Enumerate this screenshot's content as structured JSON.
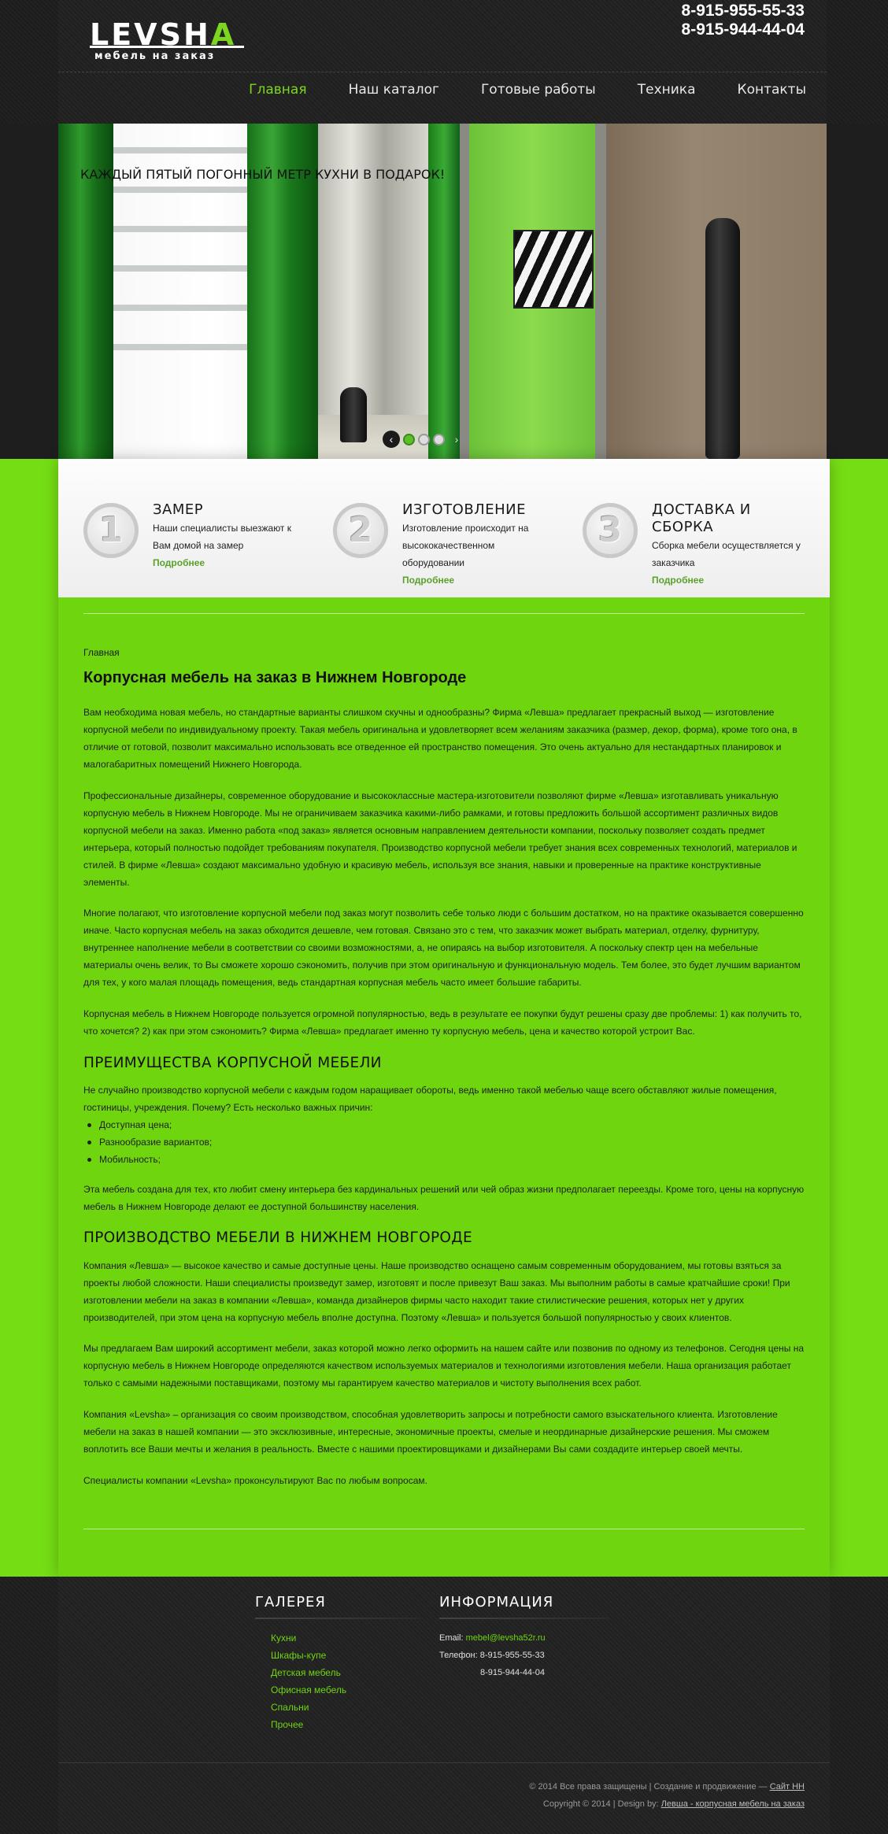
{
  "header": {
    "logo_main": "LEVSHA",
    "logo_sub": "мебель на заказ",
    "phones": [
      "8-915-955-55-33",
      "8-915-944-44-04"
    ],
    "nav": [
      {
        "label": "Главная",
        "active": true
      },
      {
        "label": "Наш каталог",
        "active": false
      },
      {
        "label": "Готовые работы",
        "active": false
      },
      {
        "label": "Техника",
        "active": false
      },
      {
        "label": "Контакты",
        "active": false
      }
    ]
  },
  "slider": {
    "caption": "КАЖДЫЙ ПЯТЫЙ ПОГОННЫЙ МЕТР КУХНИ В ПОДАРОК!",
    "prev_icon": "‹",
    "next_icon": "›",
    "dots": 3,
    "active_dot": 1
  },
  "steps": [
    {
      "num": "1",
      "title": "ЗАМЕР",
      "text": "Наши специалисты выезжают к Вам домой на замер",
      "more": "Подробнее"
    },
    {
      "num": "2",
      "title": "ИЗГОТОВЛЕНИЕ",
      "text": "Изготовление происходит на высококачественном оборудовании",
      "more": "Подробнее"
    },
    {
      "num": "3",
      "title": "ДОСТАВКА И СБОРКА",
      "text": "Сборка мебели осуществляется у заказчика",
      "more": "Подробнее"
    }
  ],
  "content": {
    "breadcrumb": "Главная",
    "title": "Корпусная мебель на заказ в Нижнем Новгороде",
    "p1": "Вам необходима новая мебель, но стандартные варианты слишком скучны и однообразны? Фирма «Левша» предлагает прекрасный выход — изготовление корпусной мебели по индивидуальному проекту. Такая мебель оригинальна и удовлетворяет всем желаниям заказчика (размер, декор, форма), кроме того она, в отличие от готовой, позволит максимально использовать все отведенное ей пространство помещения. Это очень актуально для нестандартных планировок и малогабаритных помещений Нижнего Новгорода.",
    "p2": "Профессиональные дизайнеры, современное оборудование и высококлассные мастера-изготовители позволяют фирме «Левша» изготавливать уникальную корпусную мебель в Нижнем Новгороде. Мы не ограничиваем заказчика какими-либо рамками, и готовы предложить большой ассортимент различных видов корпусной мебели на заказ. Именно работа «под заказ» является основным направлением деятельности компании, поскольку позволяет создать предмет интерьера, который полностью подойдет требованиям покупателя. Производство корпусной мебели требует знания всех современных технологий, материалов и стилей. В фирме «Левша» создают максимально удобную и красивую мебель, используя все знания, навыки и проверенные на практике конструктивные элементы.",
    "p3": "Многие полагают, что изготовление корпусной мебели под заказ могут позволить себе только люди с большим достатком, но на практике оказывается совершенно иначе. Часто корпусная мебель на заказ обходится дешевле, чем готовая. Связано это с тем, что заказчик может выбрать материал, отделку, фурнитуру, внутреннее наполнение мебели в соответствии со своими возможностями, а, не опираясь на выбор изготовителя. А поскольку спектр цен на мебельные материалы очень велик, то Вы сможете хорошо сэкономить, получив при этом оригинальную и функциональную модель. Тем более, это будет лучшим вариантом для тех, у кого малая площадь помещения, ведь стандартная корпусная мебель часто имеет большие габариты.",
    "p4": "Корпусная мебель в Нижнем Новгороде пользуется огромной популярностью, ведь в результате ее покупки будут решены сразу две проблемы: 1) как получить то, что хочется? 2) как при этом сэкономить? Фирма «Левша» предлагает именно ту корпусную мебель, цена и качество которой устроит Вас.",
    "h2a": "ПРЕИМУЩЕСТВА КОРПУСНОЙ МЕБЕЛИ",
    "p5": "Не случайно производство корпусной мебели с каждым годом наращивает обороты, ведь именно такой мебелью чаще всего обставляют жилые помещения, гостиницы, учреждения. Почему? Есть несколько важных причин:",
    "bullets": [
      "Доступная цена;",
      "Разнообразие вариантов;",
      "Мобильность;"
    ],
    "p6": "Эта мебель создана для тех, кто любит смену интерьера без кардинальных решений или чей образ жизни предполагает переезды. Кроме того, цены на корпусную мебель в Нижнем Новгороде делают ее доступной большинству населения.",
    "h2b": "ПРОИЗВОДСТВО МЕБЕЛИ В НИЖНЕМ НОВГОРОДЕ",
    "p7": "Компания «Левша» — высокое качество и самые доступные цены. Наше производство оснащено самым современным оборудованием, мы готовы взяться за проекты любой сложности. Наши специалисты произведут замер, изготовят и после привезут Ваш заказ. Мы выполним работы в самые кратчайшие сроки! При изготовлении мебели на заказ в компании «Левша», команда дизайнеров фирмы часто находит такие стилистические решения, которых нет у других производителей, при этом цена на корпусную мебель вполне доступна. Поэтому «Левша» и пользуется большой популярностью у своих клиентов.",
    "p8": "Мы предлагаем Вам широкий ассортимент мебели, заказ которой можно легко оформить на нашем сайте или позвонив по одному из телефонов. Сегодня цены на корпусную мебель в Нижнем Новгороде определяются качеством используемых материалов и технологиями изготовления мебели. Наша организация работает только с самыми надежными поставщиками, поэтому мы гарантируем качество материалов и чистоту выполнения всех работ.",
    "p9": "Компания «Levsha» – организация со своим производством, способная удовлетворить запросы и потребности самого взыскательного клиента. Изготовление мебели на заказ в нашей компании — это эксклюзивные, интересные, экономичные проекты, смелые и неординарные дизайнерские решения. Мы сможем воплотить все Ваши мечты и желания в реальность. Вместе с нашими проектировщиками и дизайнерами Вы сами создадите интерьер своей мечты.",
    "p10": "Специалисты компании «Levsha» проконсультируют Вас по любым вопросам."
  },
  "footer": {
    "gallery_title": "ГАЛЕРЕЯ",
    "gallery_links": [
      "Кухни",
      "Шкафы-купе",
      "Детская мебель",
      "Офисная мебель",
      "Спальни",
      "Прочее"
    ],
    "info_title": "ИНФОРМАЦИЯ",
    "email_label": "Email:",
    "email": "mebel@levsha52r.ru",
    "phone_label": "Телефон:",
    "phone1": "8-915-955-55-33",
    "phone2": "8-915-944-44-04",
    "copyright1": "© 2014 Все права защищены | Создание и продвижение —",
    "copyright1_link": "Сайт НН",
    "copyright2": "Copyright © 2014   |   Design by:",
    "copyright2_link": "Левша - корпусная мебель на заказ"
  }
}
